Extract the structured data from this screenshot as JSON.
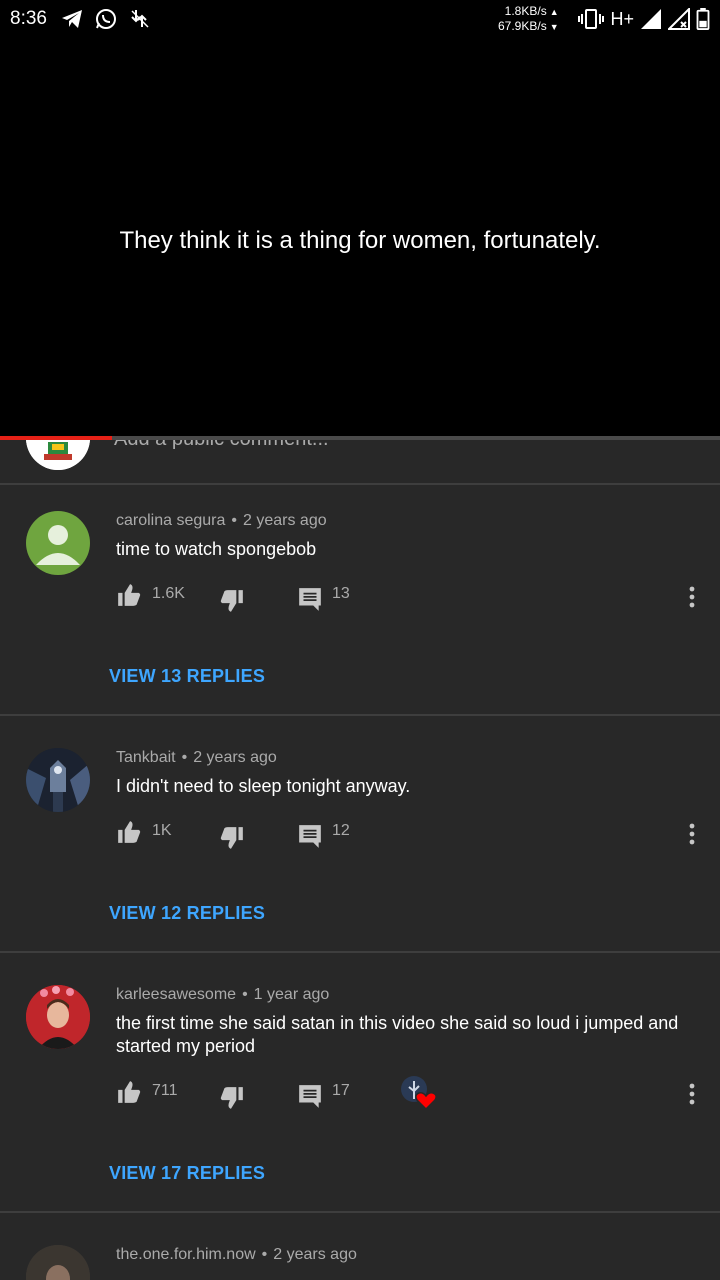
{
  "status_bar": {
    "time": "8:36",
    "net_up": "1.8KB/s",
    "net_down": "67.9KB/s",
    "network_type": "H+",
    "icons": [
      "telegram-icon",
      "whatsapp-icon",
      "download-icon",
      "vibrate-icon",
      "signal-icon",
      "signal-no-sim-icon",
      "battery-icon"
    ]
  },
  "video": {
    "subtitle": "They think it is a thing for women, fortunately.",
    "progress": 0.155,
    "progress_color": "#e62117"
  },
  "add_comment": {
    "placeholder": "Add a public comment..."
  },
  "comments": [
    {
      "author": "carolina segura",
      "time": "2 years ago",
      "text": "time to watch spongebob",
      "likes": "1.6K",
      "replies": "13",
      "view_replies": "VIEW 13 REPLIES",
      "avatar_color": "#6fa53f"
    },
    {
      "author": "Tankbait",
      "time": "2 years ago",
      "text": "I didn't need to sleep tonight anyway.",
      "likes": "1K",
      "replies": "12",
      "view_replies": "VIEW 12 REPLIES"
    },
    {
      "author": "karleesawesome",
      "time": "1 year ago",
      "text": "the first time she said satan in this video she said so loud i jumped and started my period",
      "likes": "711",
      "replies": "17",
      "view_replies": "VIEW 17 REPLIES",
      "creator_heart": true
    },
    {
      "author": "the.one.for.him.now",
      "time": "2 years ago"
    }
  ],
  "colors": {
    "background": "#282828",
    "link": "#3ea6ff",
    "secondary_text": "#aaaaaa"
  }
}
